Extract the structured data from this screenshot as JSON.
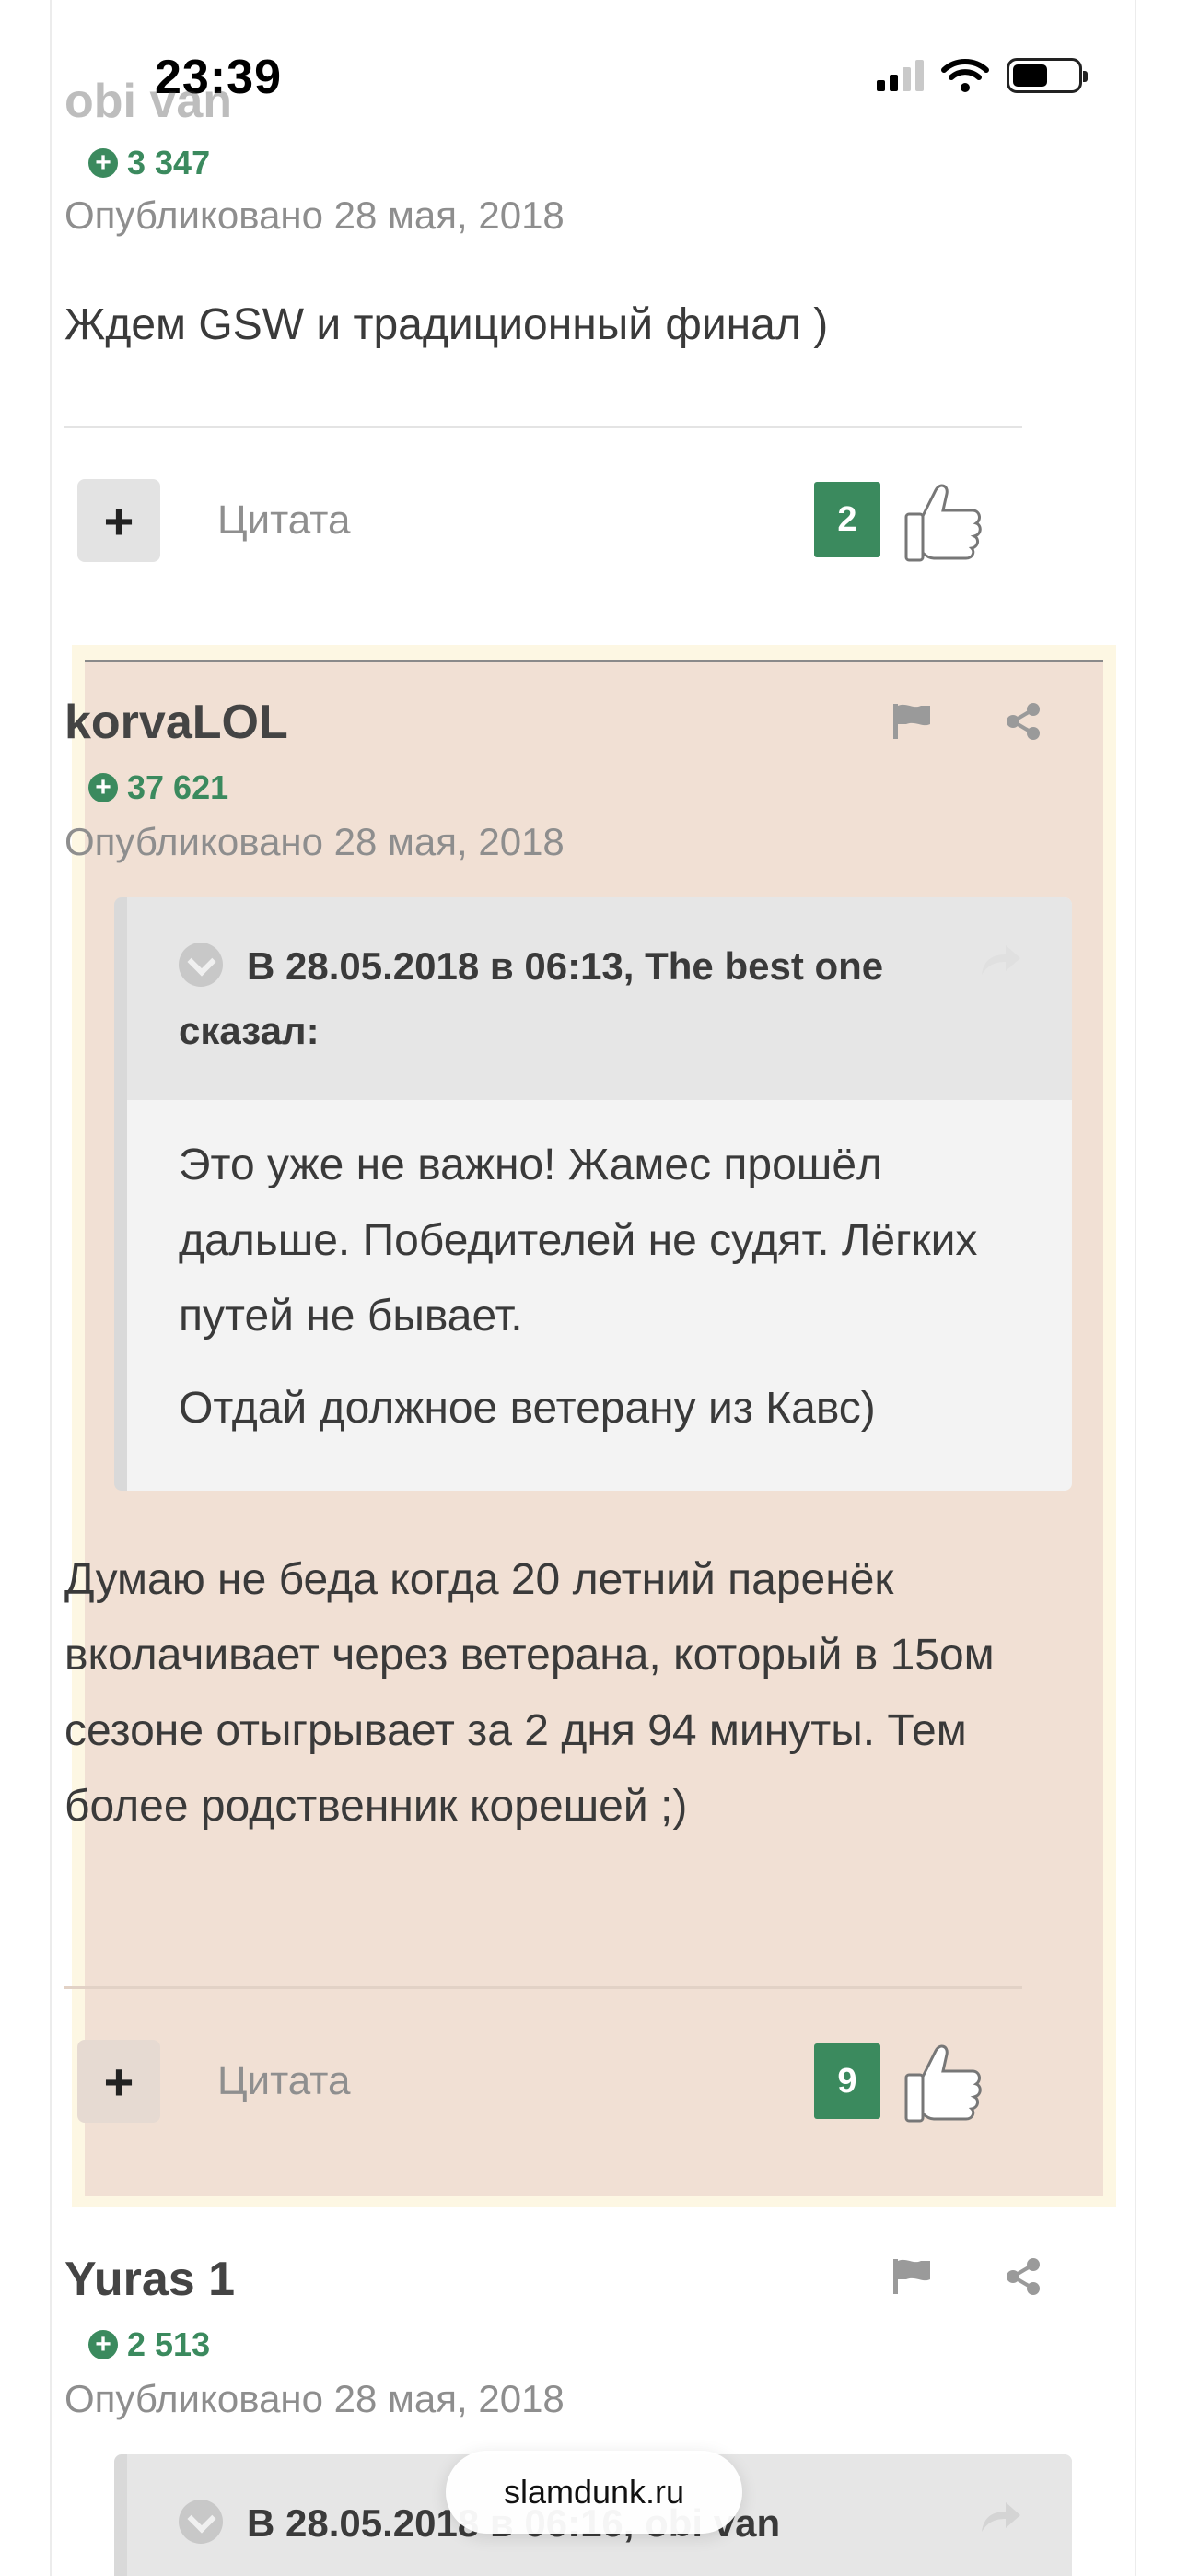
{
  "status_bar": {
    "time": "23:39"
  },
  "posts": [
    {
      "author": "obi van",
      "reputation": "3 347",
      "date": "Опубликовано 28 мая, 2018",
      "text": "Ждем GSW и традиционный финал )",
      "quote_label": "Цитата",
      "likes": "2"
    },
    {
      "author": "korvaLOL",
      "reputation": "37 621",
      "date": "Опубликовано 28 мая, 2018",
      "quote": {
        "header": "В 28.05.2018 в 06:13, The best one сказал:",
        "paragraphs": [
          "Это уже не важно! Жамес прошёл дальше. Победителей не судят. Лёгких путей не бывает.",
          "Отдай должное ветерану из Кавс)"
        ]
      },
      "text": "Думаю не беда когда 20 летний паренёк вколачивает через ветерана, который в 15ом сезоне отыгрывает за 2 дня 94 минуты. Тем более родственник корешей ;)",
      "quote_label": "Цитата",
      "likes": "9"
    },
    {
      "author": "Yuras 1",
      "reputation": "2 513",
      "date": "Опубликовано 28 мая, 2018",
      "quote": {
        "header": "В 28.05.2018 в 06:16, obi van"
      }
    }
  ],
  "browser": {
    "site": "slamdunk.ru"
  },
  "colors": {
    "accent": "#3b8a5e",
    "highlight": "#f1e0d4"
  }
}
